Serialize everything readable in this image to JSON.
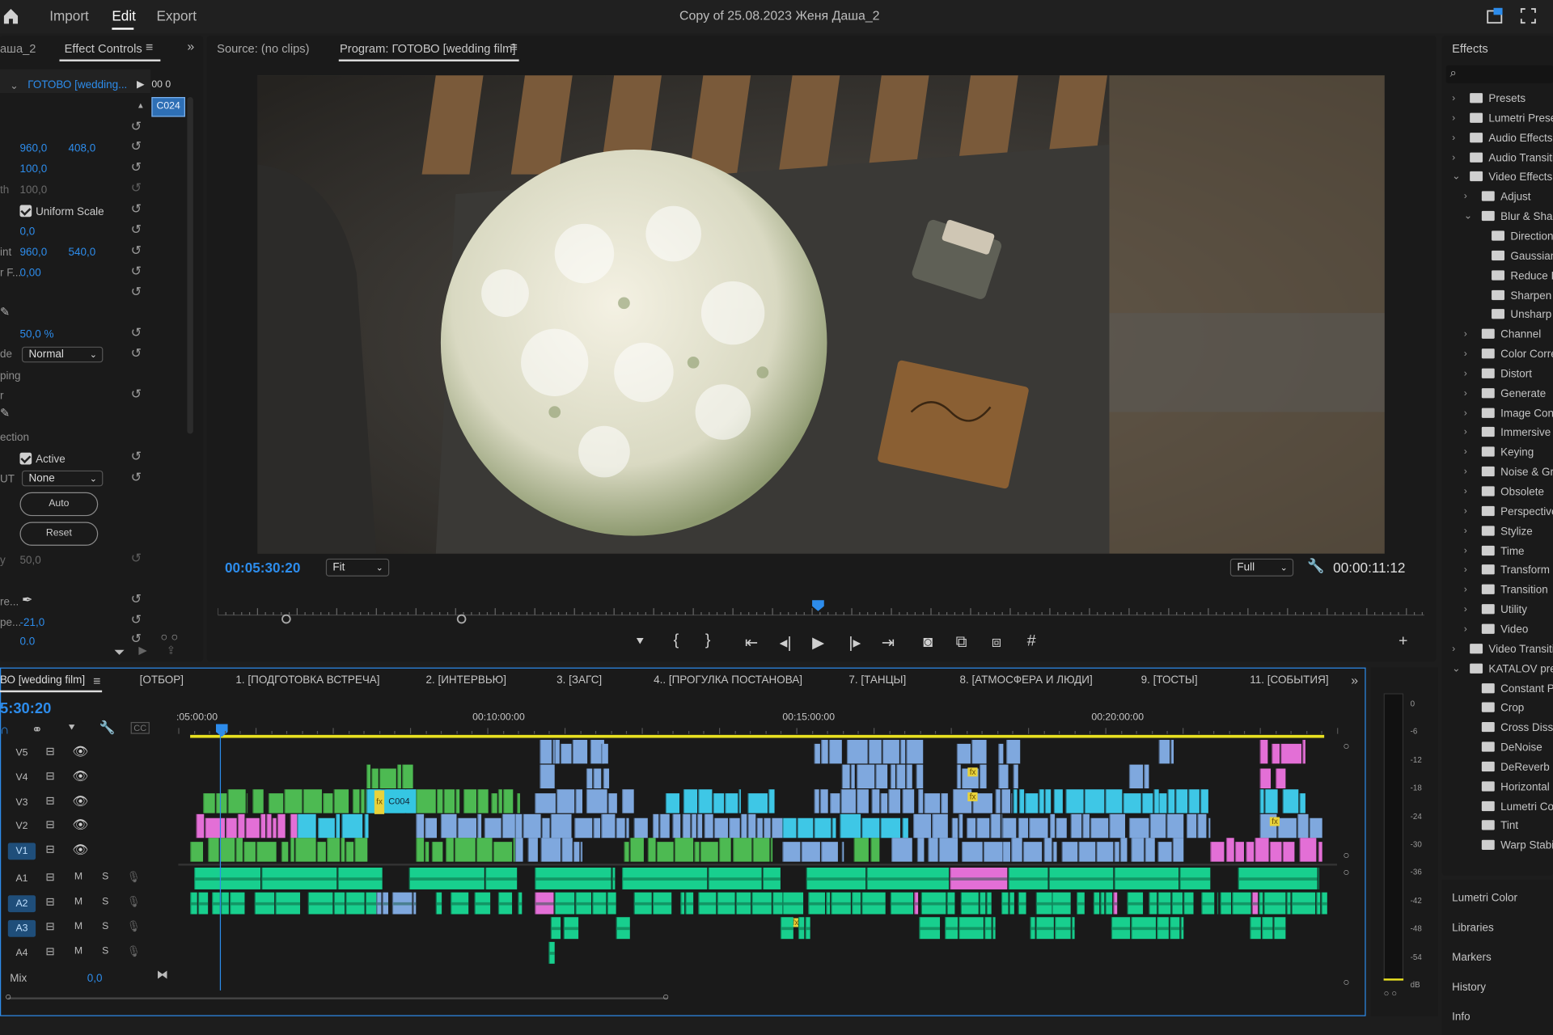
{
  "topbar": {
    "import": "Import",
    "edit": "Edit",
    "export": "Export",
    "project_title": "Copy of 25.08.2023 Женя Даша_2"
  },
  "left_panel": {
    "tab_prev": "аша_2",
    "tab_active": "Effect Controls",
    "seq_name": "ГОТОВО [wedding...",
    "mini_ruler": "00   0",
    "clip_label": "C024",
    "position": {
      "x": "960,0",
      "y": "408,0"
    },
    "scale": "100,0",
    "scale_width_label": "th",
    "scale_width": "100,0",
    "uniform_scale": "Uniform Scale",
    "rotation": "0,0",
    "anchor_label": "int",
    "anchor_x": "960,0",
    "anchor_y": "540,0",
    "flicker_label": "r F...",
    "flicker": "0,00",
    "opacity": "50,0 %",
    "blend_label": "de",
    "blend_mode": "Normal",
    "remap_label": "ping",
    "r_label": "r",
    "section_label": "ection",
    "active": "Active",
    "lut_label": "UT",
    "lut": "None",
    "auto": "Auto",
    "reset": "Reset",
    "y_label": "y",
    "y_val": "50,0",
    "pick_label": "re...",
    "temp_label": "pe...",
    "temp": "-21,0",
    "bottom_val": "0.0"
  },
  "monitor": {
    "source_tab": "Source: (no clips)",
    "program_tab": "Program: ГОТОВО [wedding film]",
    "timecode": "00:05:30:20",
    "fit": "Fit",
    "quality": "Full",
    "duration": "00:00:11:12"
  },
  "effects_panel": {
    "title": "Effects",
    "items": [
      {
        "label": "Presets",
        "level": 0,
        "kind": "preset-folder"
      },
      {
        "label": "Lumetri Prese",
        "level": 0,
        "kind": "preset-folder"
      },
      {
        "label": "Audio Effects",
        "level": 0,
        "kind": "folder"
      },
      {
        "label": "Audio Transiti",
        "level": 0,
        "kind": "folder"
      },
      {
        "label": "Video Effects",
        "level": 0,
        "kind": "folder",
        "open": true
      },
      {
        "label": "Adjust",
        "level": 1,
        "kind": "folder"
      },
      {
        "label": "Blur & Shar",
        "level": 1,
        "kind": "folder",
        "open": true
      },
      {
        "label": "Direction",
        "level": 2,
        "kind": "effect"
      },
      {
        "label": "Gaussian",
        "level": 2,
        "kind": "effect"
      },
      {
        "label": "Reduce Ir",
        "level": 2,
        "kind": "effect"
      },
      {
        "label": "Sharpen",
        "level": 2,
        "kind": "effect"
      },
      {
        "label": "Unsharp I",
        "level": 2,
        "kind": "effect"
      },
      {
        "label": "Channel",
        "level": 1,
        "kind": "folder"
      },
      {
        "label": "Color Corre",
        "level": 1,
        "kind": "folder"
      },
      {
        "label": "Distort",
        "level": 1,
        "kind": "folder"
      },
      {
        "label": "Generate",
        "level": 1,
        "kind": "folder"
      },
      {
        "label": "Image Cont",
        "level": 1,
        "kind": "folder"
      },
      {
        "label": "Immersive \\",
        "level": 1,
        "kind": "folder"
      },
      {
        "label": "Keying",
        "level": 1,
        "kind": "folder"
      },
      {
        "label": "Noise & Gra",
        "level": 1,
        "kind": "folder"
      },
      {
        "label": "Obsolete",
        "level": 1,
        "kind": "folder"
      },
      {
        "label": "Perspective",
        "level": 1,
        "kind": "folder"
      },
      {
        "label": "Stylize",
        "level": 1,
        "kind": "folder"
      },
      {
        "label": "Time",
        "level": 1,
        "kind": "folder"
      },
      {
        "label": "Transform",
        "level": 1,
        "kind": "folder"
      },
      {
        "label": "Transition",
        "level": 1,
        "kind": "folder"
      },
      {
        "label": "Utility",
        "level": 1,
        "kind": "folder"
      },
      {
        "label": "Video",
        "level": 1,
        "kind": "folder"
      },
      {
        "label": "Video Transiti",
        "level": 0,
        "kind": "folder"
      },
      {
        "label": "KATALOV pres",
        "level": 0,
        "kind": "folder",
        "open": true
      },
      {
        "label": "Constant Po",
        "level": 1,
        "kind": "preset"
      },
      {
        "label": "Crop",
        "level": 1,
        "kind": "preset"
      },
      {
        "label": "Cross Disso",
        "level": 1,
        "kind": "preset"
      },
      {
        "label": "DeNoise",
        "level": 1,
        "kind": "preset"
      },
      {
        "label": "DeReverb",
        "level": 1,
        "kind": "preset"
      },
      {
        "label": "Horizontal I",
        "level": 1,
        "kind": "preset"
      },
      {
        "label": "Lumetri Col",
        "level": 1,
        "kind": "preset"
      },
      {
        "label": "Tint",
        "level": 1,
        "kind": "preset"
      },
      {
        "label": "Warp Stabil",
        "level": 1,
        "kind": "preset"
      }
    ]
  },
  "side_panels": [
    "Lumetri Color",
    "Libraries",
    "Markers",
    "History",
    "Info"
  ],
  "timeline": {
    "active_tab": "ВО [wedding film]",
    "tabs": [
      "[ОТБОР]",
      "1. [ПОДГОТОВКА ВСТРЕЧА]",
      "2. [ИНТЕРВЬЮ]",
      "3. [ЗАГС]",
      "4.. [ПРОГУЛКА ПОСТАНОВА]",
      "7. [ТАНЦЫ]",
      "8. [АТМОСФЕРА И ЛЮДИ]",
      "9. [ТОСТЫ]",
      "11. [СОБЫТИЯ]"
    ],
    "timecode": "5:30:20",
    "ruler": [
      ":05:00:00",
      "00:10:00:00",
      "00:15:00:00",
      "00:20:00:00"
    ],
    "video_tracks": [
      "V5",
      "V4",
      "V3",
      "V2",
      "V1"
    ],
    "audio_tracks": [
      "A1",
      "A2",
      "A3",
      "A4"
    ],
    "mix_label": "Mix",
    "mix_value": "0,0",
    "clip_name": "C004",
    "fx": "fx"
  },
  "meter": {
    "labels": [
      "0",
      "-6",
      "-12",
      "-18",
      "-24",
      "-30",
      "-36",
      "-42",
      "-48",
      "-54",
      "dB"
    ]
  },
  "colors": {
    "accent": "#2d8ceb",
    "v_green": "#4dba52",
    "v_cyan": "#3ec7e6",
    "v_blue": "#7fa8de",
    "v_pink": "#e36fd6",
    "a_green": "#18cf8e",
    "yellow": "#e8e021"
  }
}
